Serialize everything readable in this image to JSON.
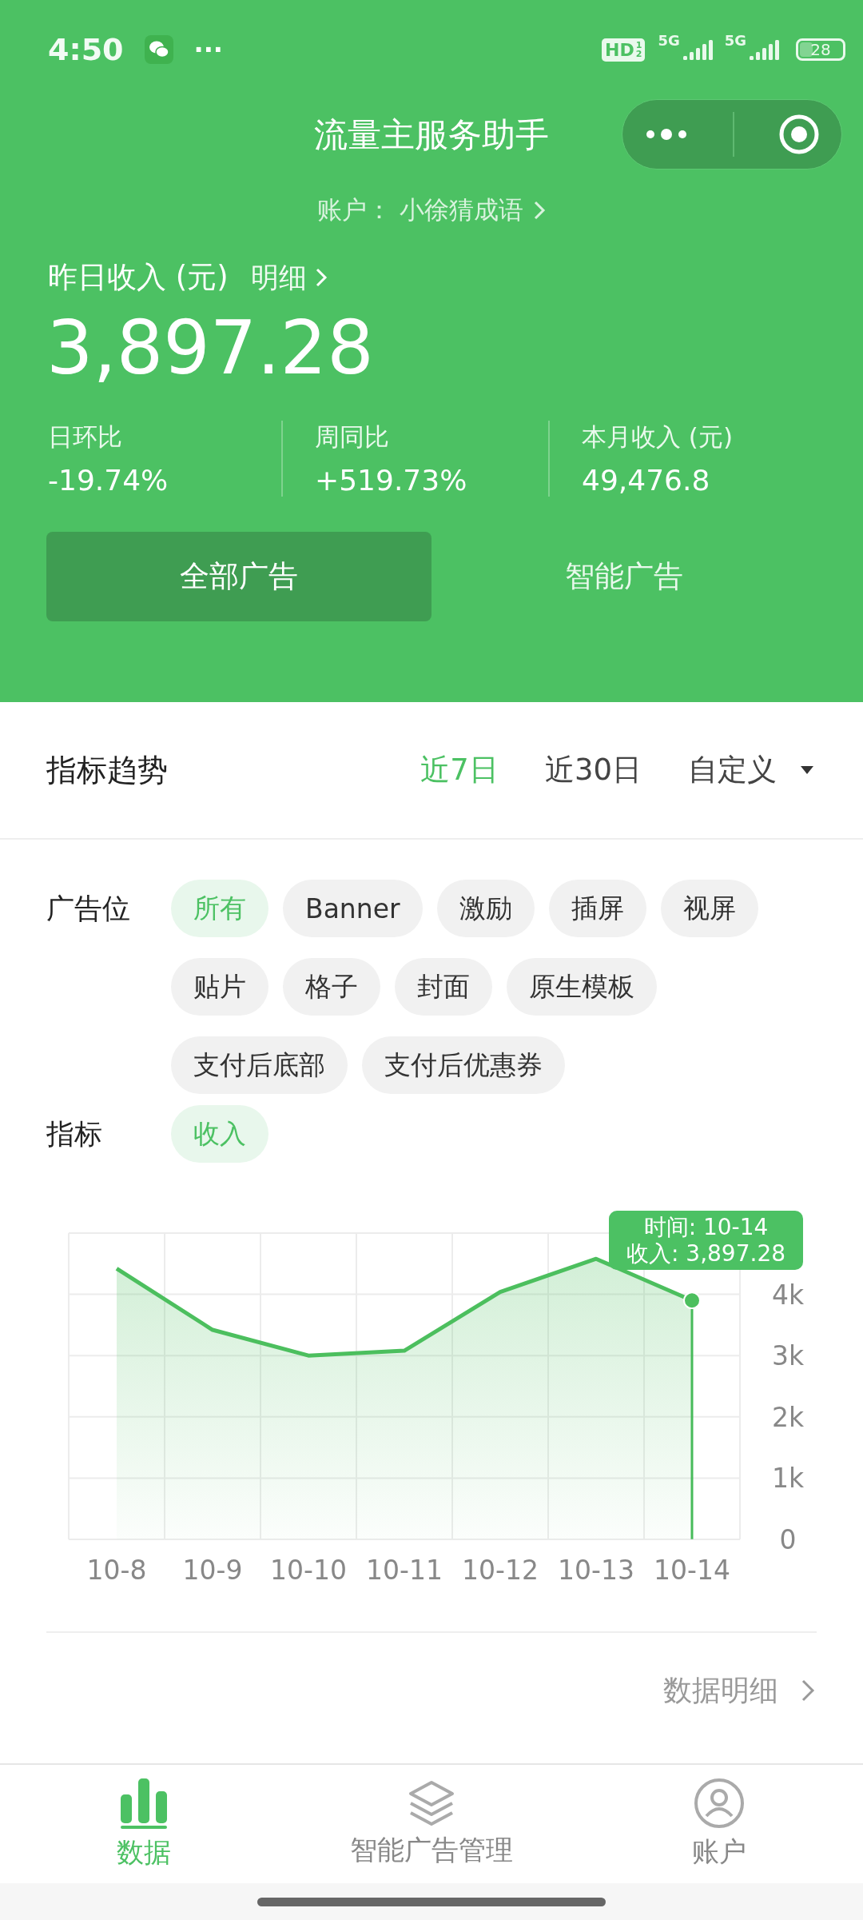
{
  "status_bar": {
    "time": "4:50",
    "dots": "···",
    "hd": "HD",
    "hd_marks": [
      "1",
      "2"
    ],
    "networks": [
      "5G",
      "5G"
    ],
    "battery": "28"
  },
  "header": {
    "title": "流量主服务助手",
    "account_label": "账户：",
    "account_name": "小徐猜成语"
  },
  "income": {
    "label": "昨日收入 (元)",
    "detail_link": "明细",
    "amount": "3,897.28",
    "stats": [
      {
        "label": "日环比",
        "value": "-19.74%"
      },
      {
        "label": "周同比",
        "value": "+519.73%"
      },
      {
        "label": "本月收入 (元)",
        "value": "49,476.8"
      }
    ]
  },
  "ad_tabs": [
    {
      "label": "全部广告",
      "selected": true
    },
    {
      "label": "智能广告",
      "selected": false
    }
  ],
  "trend": {
    "title": "指标趋势",
    "ranges": [
      {
        "label": "近7日",
        "selected": true
      },
      {
        "label": "近30日",
        "selected": false
      },
      {
        "label": "自定义",
        "selected": false
      }
    ]
  },
  "filters": [
    {
      "label": "广告位",
      "chips": [
        {
          "label": "所有",
          "selected": true
        },
        {
          "label": "Banner",
          "selected": false
        },
        {
          "label": "激励",
          "selected": false
        },
        {
          "label": "插屏",
          "selected": false
        },
        {
          "label": "视屏",
          "selected": false
        },
        {
          "label": "贴片",
          "selected": false
        },
        {
          "label": "格子",
          "selected": false
        },
        {
          "label": "封面",
          "selected": false
        },
        {
          "label": "原生模板",
          "selected": false
        },
        {
          "label": "支付后底部",
          "selected": false
        },
        {
          "label": "支付后优惠券",
          "selected": false
        }
      ]
    },
    {
      "label": "指标",
      "chips": [
        {
          "label": "收入",
          "selected": true
        }
      ]
    }
  ],
  "chart": {
    "chart_data": {
      "type": "area",
      "categories": [
        "10-8",
        "10-9",
        "10-10",
        "10-11",
        "10-12",
        "10-13",
        "10-14"
      ],
      "series": [
        {
          "color": "#4cbf5e",
          "values": [
            4420,
            3420,
            3000,
            3080,
            4040,
            4580,
            3900
          ]
        }
      ],
      "ylim": [
        0,
        5000
      ],
      "grid": true,
      "yticks": [
        {
          "value": 0,
          "label": "0"
        },
        {
          "value": 1000,
          "label": "1k"
        },
        {
          "value": 2000,
          "label": "2k"
        },
        {
          "value": 3000,
          "label": "3k"
        },
        {
          "value": 4000,
          "label": "4k"
        }
      ]
    },
    "tooltip": [
      "时间: 10-14",
      "收入: 3,897.28"
    ]
  },
  "detail_link": "数据明细",
  "bottom_tabs": [
    {
      "label": "数据",
      "kind": "bars",
      "selected": true
    },
    {
      "label": "智能广告管理",
      "kind": "layers",
      "selected": false
    },
    {
      "label": "账户",
      "kind": "user",
      "selected": false
    }
  ]
}
